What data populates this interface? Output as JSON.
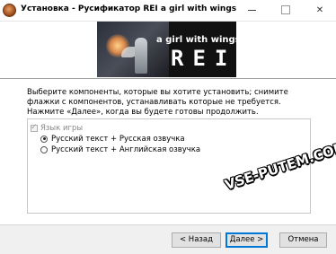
{
  "window": {
    "title": "Установка - Русификатор REI a girl with wings"
  },
  "banner": {
    "subtitle": "a girl with wings",
    "logo": "REI"
  },
  "instructions": "Выберите компоненты, которые вы хотите установить; снимите флажки с компонентов, устанавливать которые не требуется. Нажмите «Далее», когда вы будете готовы продолжить.",
  "components": {
    "group": {
      "label": "Язык игры",
      "checked": true,
      "disabled": true
    },
    "options": [
      {
        "label": "Русский текст + Русская озвучка",
        "selected": true
      },
      {
        "label": "Русский текст + Английская озвучка",
        "selected": false
      }
    ]
  },
  "watermark": "VSE-PUTEM.COM",
  "buttons": {
    "back": "< Назад",
    "next": "Далее >",
    "cancel": "Отмена"
  }
}
